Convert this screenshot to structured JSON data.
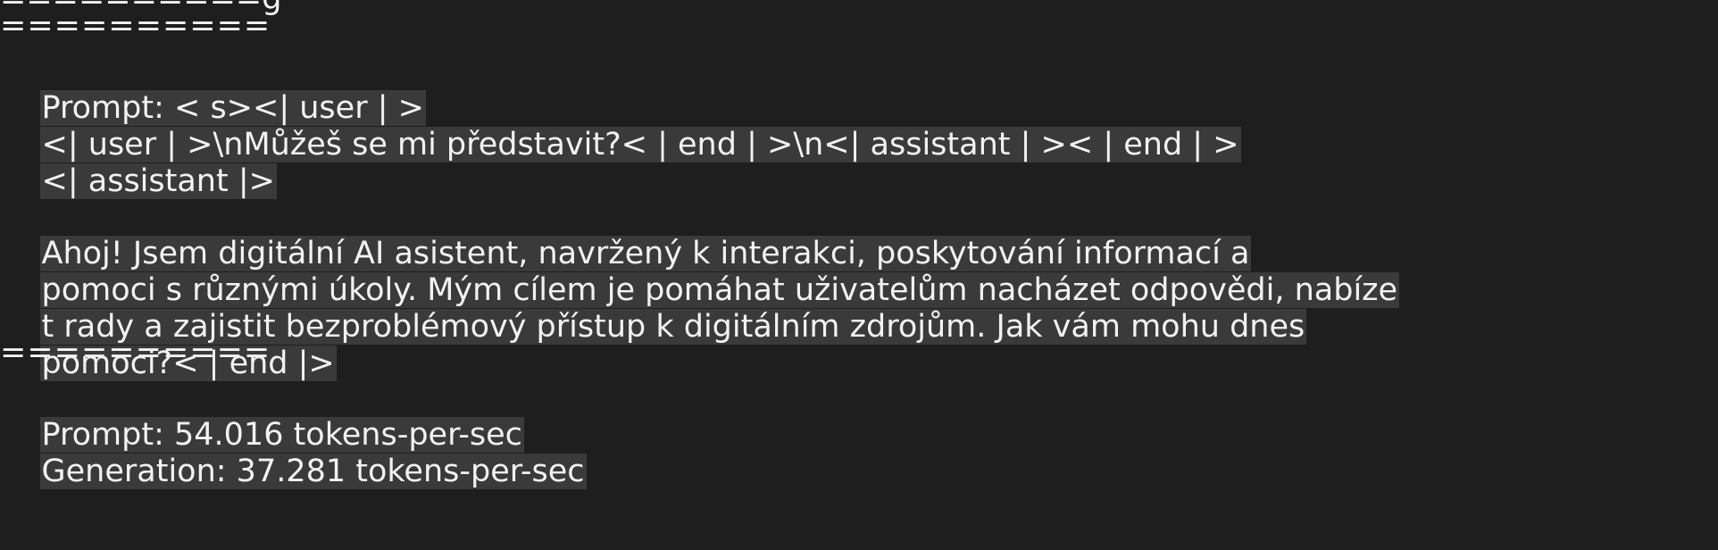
{
  "terminal": {
    "partial_top_line": "==========g",
    "separator_top": "==========",
    "prompt_line": "Prompt: < s><| user | >",
    "user_line": "<| user | >\\nMůžeš se mi představit?< | end | >\\n<| assistant | >< | end | >",
    "assistant_tag_line": "<| assistant |>",
    "response_lines": [
      "Ahoj! Jsem digitální AI asistent, navržený k interakci, poskytování informací a",
      "pomoci s různými úkoly. Mým cílem je pomáhat uživatelům nacházet odpovědi, nabíze",
      "t rady a zajistit bezproblémový přístup k digitálním zdrojům. Jak vám mohu dnes",
      "pomoci?< | end |>"
    ],
    "separator_bottom": "==========",
    "stats_prompt": "Prompt: 54.016 tokens-per-sec",
    "stats_generation": "Generation: 37.281 tokens-per-sec"
  },
  "colors": {
    "background": "#1e1e1e",
    "text": "#f2f2f2",
    "highlight": "#3a3a3a"
  }
}
